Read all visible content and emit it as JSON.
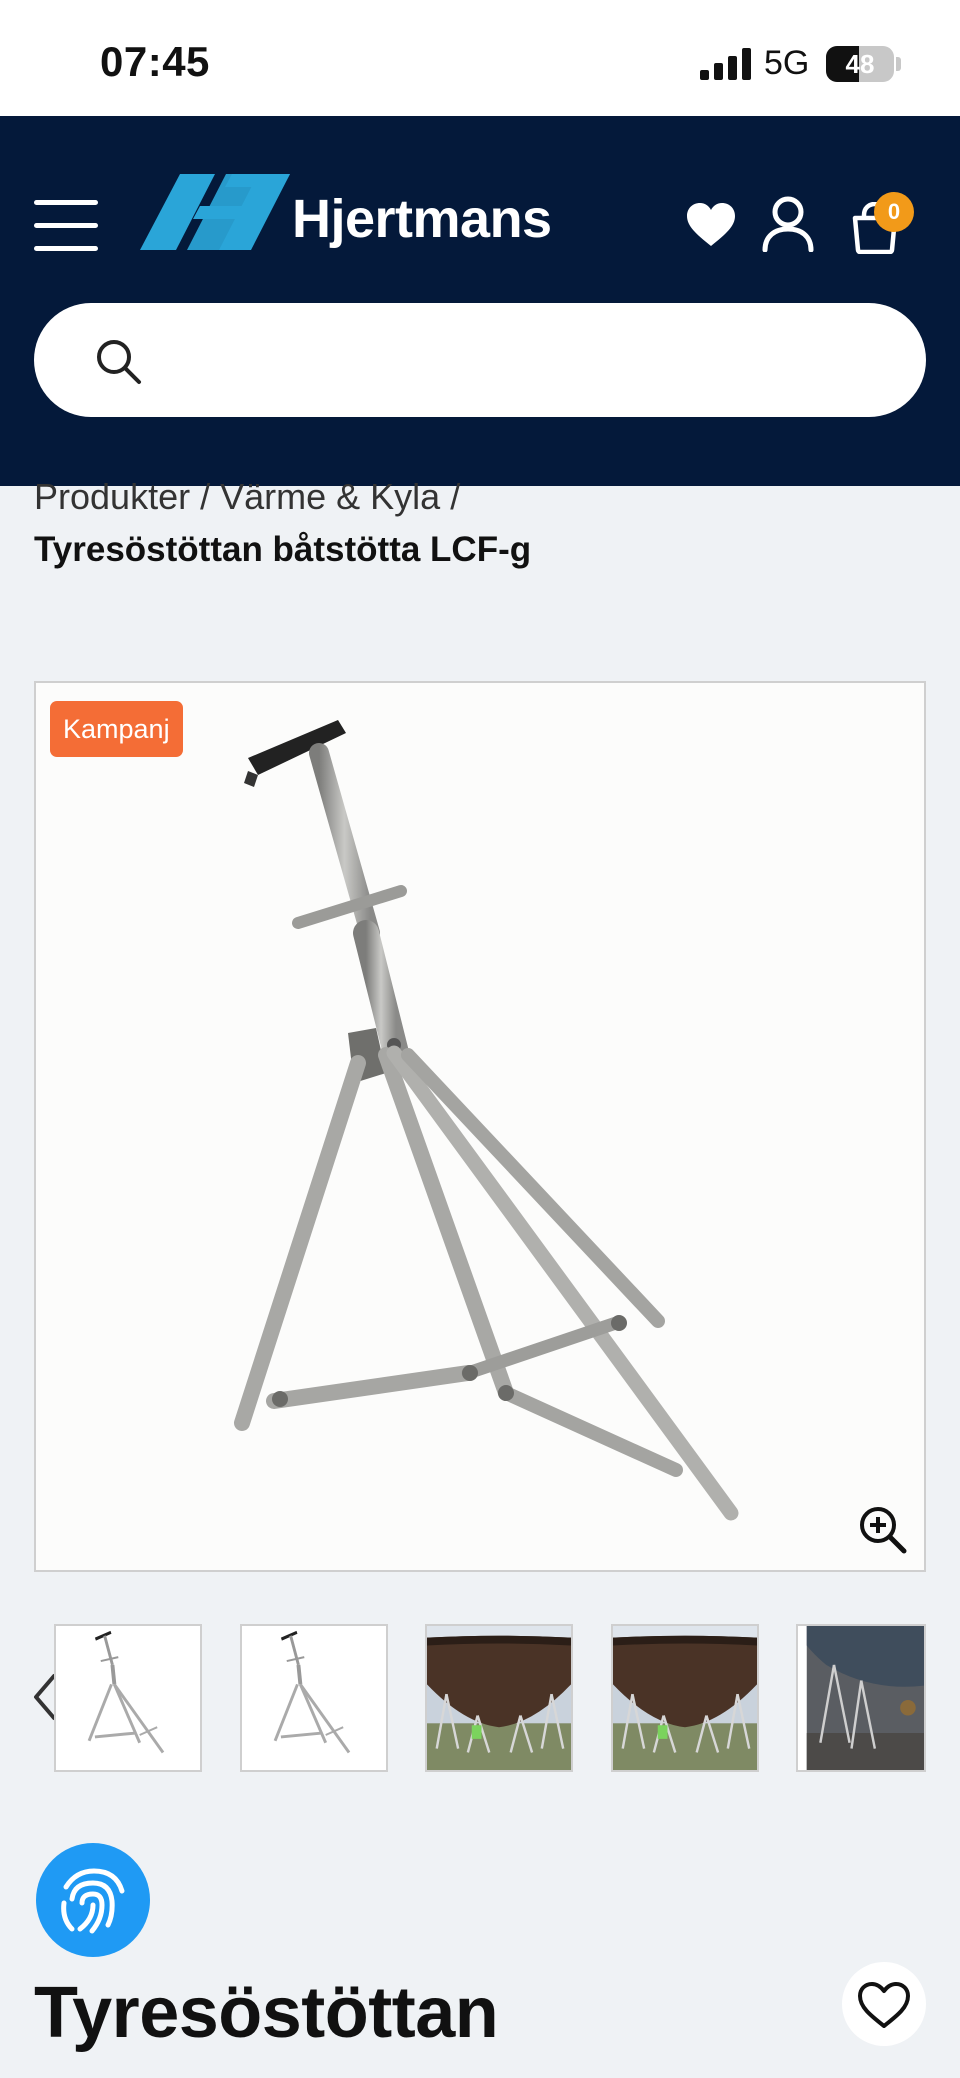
{
  "status_bar": {
    "time": "07:45",
    "network": "5G",
    "battery_level": "48",
    "battery_fraction": 0.48
  },
  "header": {
    "brand_name": "Hjertmans",
    "icons": [
      "menu-icon",
      "heart-icon",
      "account-icon",
      "cart-icon"
    ],
    "cart_count": "0",
    "colors": {
      "background": "#04193a",
      "logo_accent": "#2aa5d8",
      "badge": "#f29a19"
    }
  },
  "search": {
    "placeholder": "",
    "value": ""
  },
  "breadcrumb": {
    "items": [
      "Produkter",
      "Värme & Kyla"
    ],
    "separator": "/",
    "current": "Tyresöstöttan båtstötta LCF-g"
  },
  "gallery": {
    "badge": "Kampanj",
    "badge_color": "#f46d36",
    "thumbnails": [
      "boat-stand-photo",
      "boat-stand-photo",
      "boat-on-stands-photo",
      "boat-on-stands-photo",
      "boat-hull-stands-photo"
    ]
  },
  "product": {
    "title": "Tyresöstöttan",
    "brand_logo": "fingerprint-icon",
    "brand_color": "#1f9af4"
  }
}
